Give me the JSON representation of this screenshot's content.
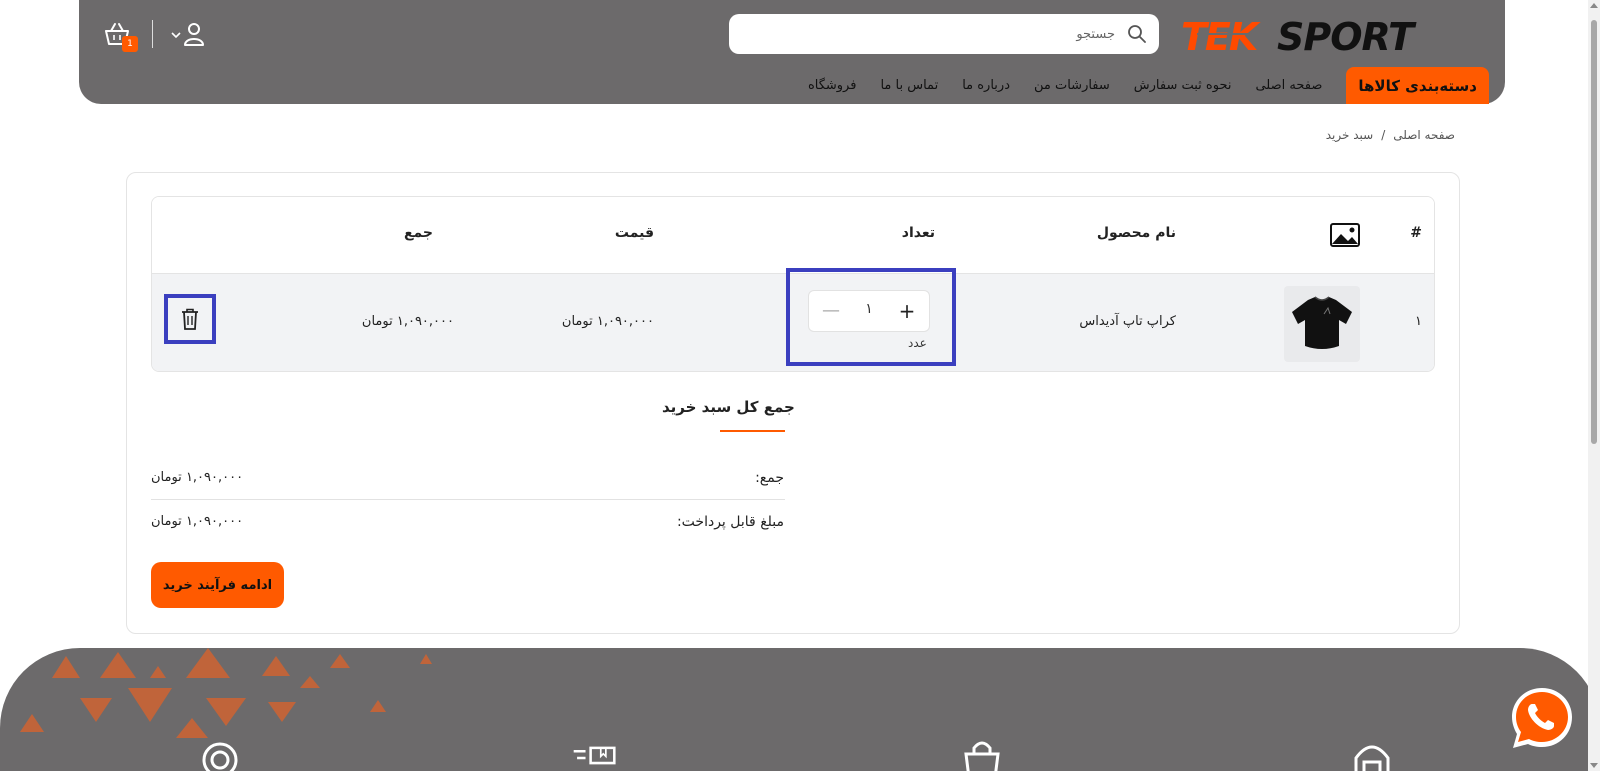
{
  "header": {
    "search_placeholder": "جستجو",
    "cart_count": "1",
    "nav": {
      "categories": "دسته‌بندی کالاها",
      "items": [
        "صفحه اصلی",
        "نحوه ثبت سفارش",
        "سفارشات من",
        "درباره ما",
        "تماس با ما",
        "فروشگاه"
      ]
    }
  },
  "breadcrumb": {
    "home": "صفحه اصلی",
    "separator": "/",
    "current": "سبد خرید"
  },
  "cart_table": {
    "headers": {
      "index": "#",
      "image_icon": "image-icon",
      "name": "نام محصول",
      "quantity": "تعداد",
      "price": "قیمت",
      "total": "جمع"
    },
    "rows": [
      {
        "index": "۱",
        "name": "کراپ تاپ آدیداس",
        "quantity": "۱",
        "unit": "عدد",
        "price": "۱,۰۹۰,۰۰۰ تومان",
        "total": "۱,۰۹۰,۰۰۰ تومان"
      }
    ]
  },
  "totals": {
    "title": "جمع کل سبد خرید",
    "subtotal_label": "جمع:",
    "subtotal_value": "۱,۰۹۰,۰۰۰ تومان",
    "payable_label": "مبلغ قابل پرداخت:",
    "payable_value": "۱,۰۹۰,۰۰۰ تومان",
    "checkout_label": "ادامه فرآیند خرید"
  },
  "colors": {
    "accent": "#ff5a00",
    "header_bg": "#6c6a6b",
    "highlight": "#3b3fbf",
    "row_bg": "#f2f3f5"
  },
  "icons": [
    "search-icon",
    "cart-icon",
    "user-icon",
    "chevron-down-icon",
    "image-icon",
    "trash-icon",
    "whatsapp-icon",
    "location-icon",
    "delivery-icon",
    "shopping-bag-icon",
    "support-icon"
  ]
}
